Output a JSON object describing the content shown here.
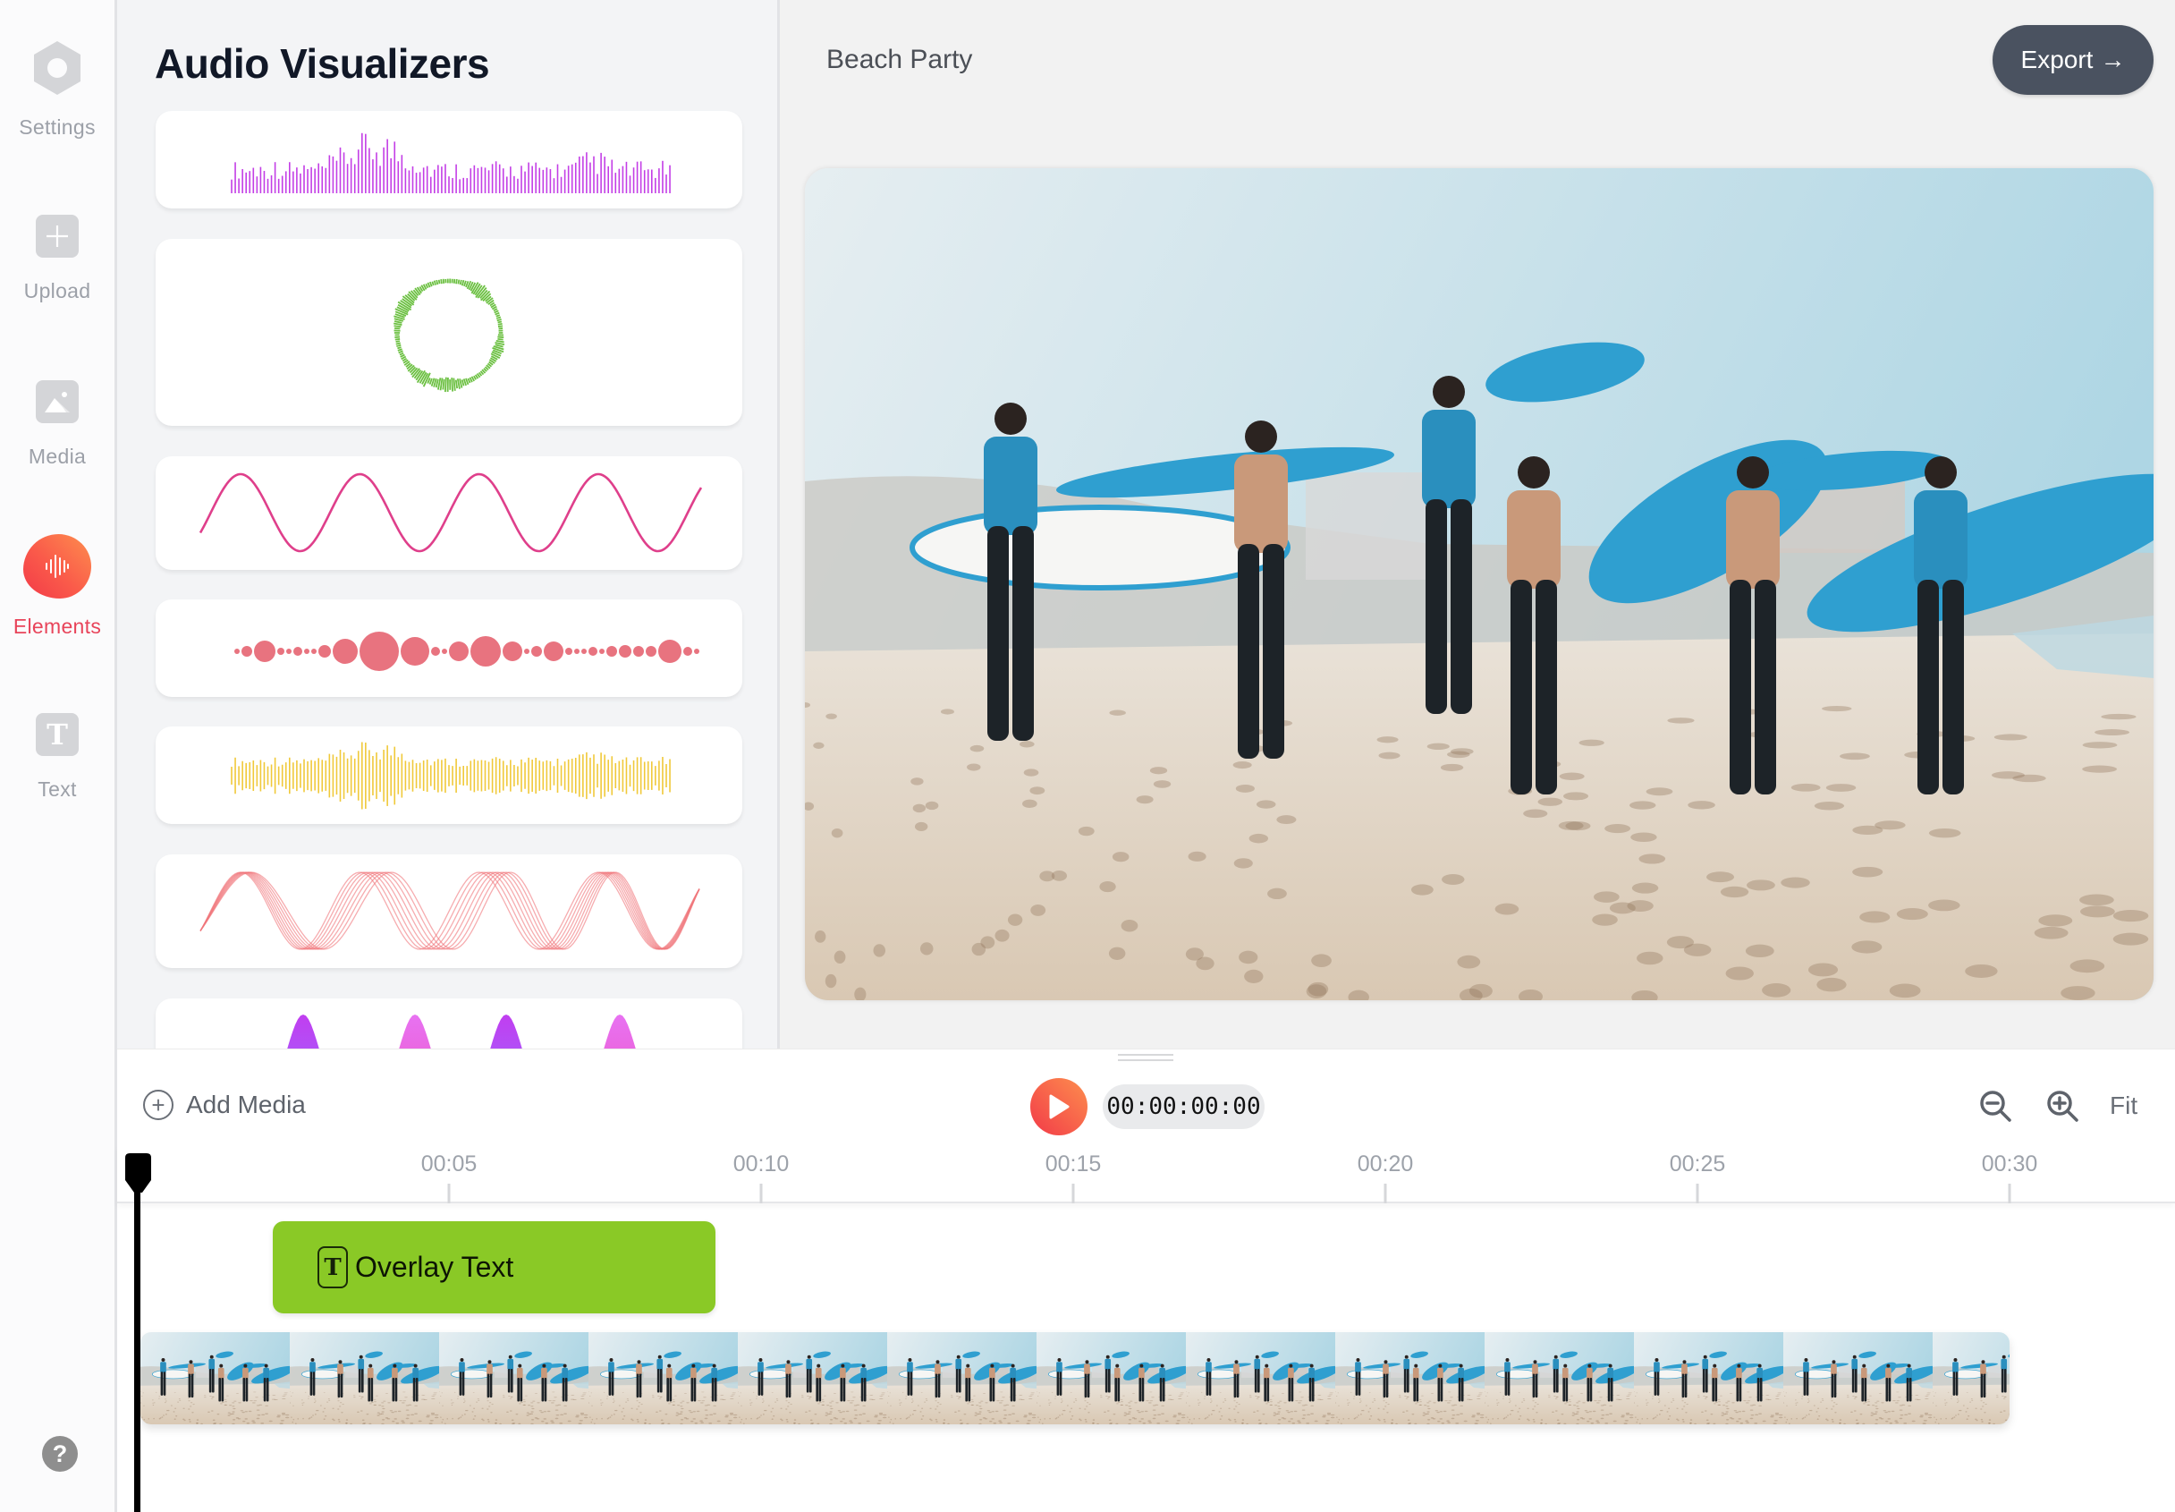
{
  "nav": {
    "items": [
      {
        "id": "settings",
        "label": "Settings",
        "icon": "settings-icon",
        "active": false
      },
      {
        "id": "upload",
        "label": "Upload",
        "icon": "plus-icon",
        "active": false
      },
      {
        "id": "media",
        "label": "Media",
        "icon": "image-icon",
        "active": false
      },
      {
        "id": "elements",
        "label": "Elements",
        "icon": "waveform-icon",
        "active": true
      },
      {
        "id": "text",
        "label": "Text",
        "icon": "text-icon",
        "active": false
      }
    ],
    "help_icon": "help-icon",
    "help_glyph": "?"
  },
  "panel": {
    "title": "Audio Visualizers",
    "visualizers": [
      {
        "name": "Bar Spectrum",
        "style": "bars-up",
        "color": "#c33ee6"
      },
      {
        "name": "Circular Wave",
        "style": "radial",
        "color": "#6cc042"
      },
      {
        "name": "Sine Line",
        "style": "sine",
        "color": "#df3f8b"
      },
      {
        "name": "Dot Pulse",
        "style": "dots",
        "color": "#e8737f"
      },
      {
        "name": "Mirrored Bars",
        "style": "bars-mirror",
        "color": "#f0c93a"
      },
      {
        "name": "Layered Sine",
        "style": "multi-sine",
        "color": "#f0757a"
      },
      {
        "name": "Gradient Hills",
        "style": "hills",
        "color": "#c44dff"
      }
    ]
  },
  "header": {
    "project_title": "Beach Party",
    "export_label": "Export",
    "export_icon": "→"
  },
  "preview": {
    "description": "Group of surfers carrying blue surfboards on a sandy beach"
  },
  "timeline": {
    "add_media_label": "Add Media",
    "add_media_icon": "+",
    "timecode": "00:00:00:00",
    "fit_label": "Fit",
    "ruler_labels": [
      "00:05",
      "00:10",
      "00:15",
      "00:20",
      "00:25",
      "00:30"
    ],
    "overlay_clip": {
      "icon_glyph": "T",
      "label": "Overlay Text",
      "color": "#8ac926"
    },
    "video_clip": {
      "frames": 13
    }
  },
  "colors": {
    "accent": "#f24e4e",
    "active_nav": "#e8445a",
    "export_bg": "#4a5260"
  }
}
